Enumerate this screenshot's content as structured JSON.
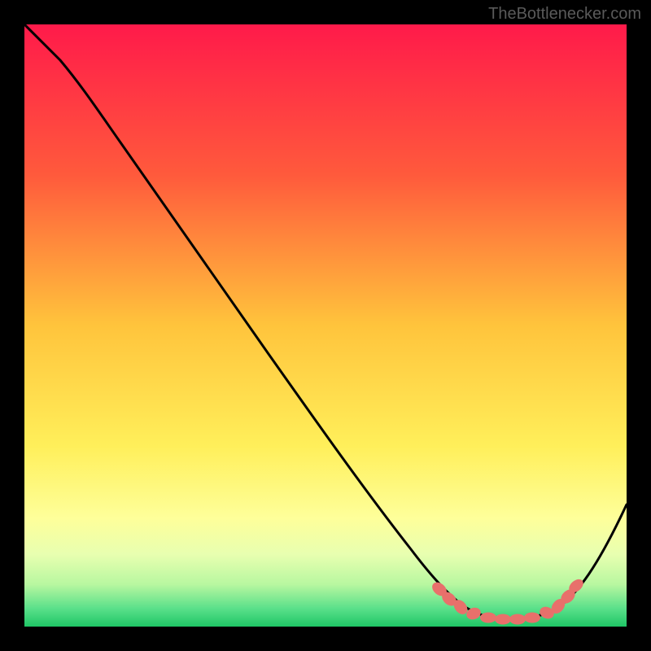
{
  "watermark": "TheBottlenecker.com",
  "chart_data": {
    "type": "line",
    "title": "",
    "xlabel": "",
    "ylabel": "",
    "xlim": [
      0,
      100
    ],
    "ylim": [
      0,
      100
    ],
    "series": [
      {
        "name": "bottleneck-curve",
        "x": [
          0,
          6,
          14,
          24,
          34,
          44,
          54,
          64,
          68,
          72,
          76,
          80,
          84,
          88,
          92,
          100
        ],
        "y": [
          100,
          94,
          83,
          70,
          57,
          44,
          31,
          18,
          12,
          7,
          3.5,
          2,
          2,
          3,
          6,
          22
        ]
      }
    ],
    "markers": {
      "name": "optimal-zone",
      "x": [
        70,
        72,
        74,
        76,
        78,
        80,
        82,
        84,
        86,
        88,
        90
      ],
      "y": [
        8,
        6,
        4.5,
        3.5,
        2.8,
        2.2,
        2,
        2.2,
        3,
        4,
        6
      ]
    },
    "gradient_stops": [
      {
        "pos": 0,
        "color": "#ff1a4a"
      },
      {
        "pos": 0.25,
        "color": "#ff5a3c"
      },
      {
        "pos": 0.5,
        "color": "#ffc43c"
      },
      {
        "pos": 0.7,
        "color": "#ffef5a"
      },
      {
        "pos": 0.82,
        "color": "#feff9a"
      },
      {
        "pos": 0.92,
        "color": "#d8ff9a"
      },
      {
        "pos": 1.0,
        "color": "#27d36b"
      }
    ]
  }
}
